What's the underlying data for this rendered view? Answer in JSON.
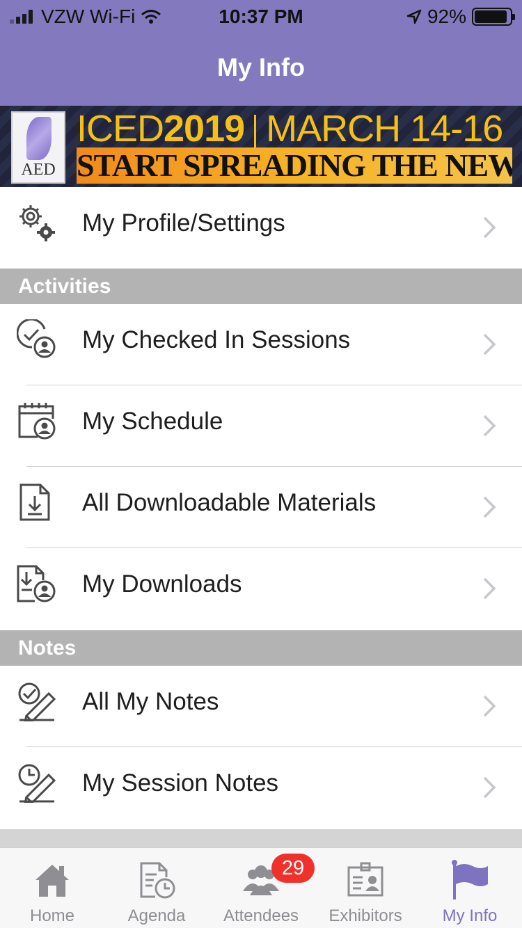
{
  "status_bar": {
    "carrier": "VZW Wi-Fi",
    "time": "10:37 PM",
    "battery_percent": "92%",
    "battery_level": 0.92
  },
  "header": {
    "title": "My Info"
  },
  "banner": {
    "logo_text": "AED",
    "event_prefix": "ICED",
    "event_year": "2019",
    "event_dates": "MARCH 14-16",
    "tagline": "START SPREADING THE NEWS"
  },
  "profile": {
    "label": "My Profile/Settings",
    "icon": "gears-icon"
  },
  "sections": {
    "activities": {
      "title": "Activities",
      "items": [
        {
          "label": "My Checked In Sessions",
          "icon": "check-user-icon"
        },
        {
          "label": "My Schedule",
          "icon": "calendar-user-icon"
        },
        {
          "label": "All Downloadable Materials",
          "icon": "document-download-icon"
        },
        {
          "label": "My Downloads",
          "icon": "download-user-icon"
        }
      ]
    },
    "notes": {
      "title": "Notes",
      "items": [
        {
          "label": "All My Notes",
          "icon": "check-pencil-icon"
        },
        {
          "label": "My Session Notes",
          "icon": "clock-pencil-icon"
        }
      ]
    }
  },
  "tab_bar": {
    "tabs": [
      {
        "label": "Home",
        "icon": "home-icon"
      },
      {
        "label": "Agenda",
        "icon": "agenda-icon"
      },
      {
        "label": "Attendees",
        "icon": "attendees-icon",
        "badge": "29"
      },
      {
        "label": "Exhibitors",
        "icon": "exhibitors-icon"
      },
      {
        "label": "My Info",
        "icon": "flag-icon",
        "active": true
      }
    ]
  },
  "colors": {
    "header": "#8279be",
    "accent": "#7e73c0",
    "section": "#b3b3b3",
    "badge": "#f0302b"
  }
}
